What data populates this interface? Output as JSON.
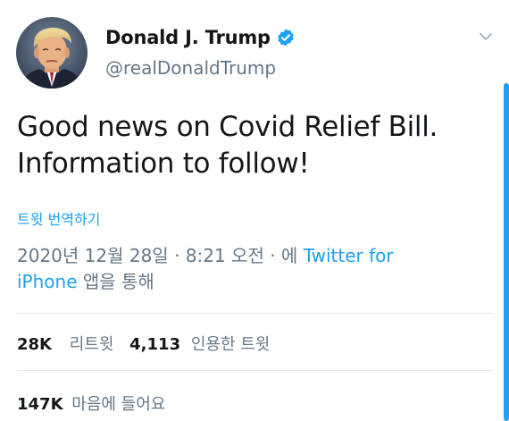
{
  "author": {
    "display_name": "Donald J. Trump",
    "handle": "@realDonaldTrump",
    "verified": true,
    "avatar_icon": "profile-photo"
  },
  "tweet": {
    "text_line1": "Good news on Covid Relief Bill.",
    "text_line2": "Information to follow!",
    "translate_label": "트윗 번역하기"
  },
  "meta": {
    "timestamp": "2020년 12월 28일 · 8:21 오전 · 에 ",
    "source_part1": "Twitter for",
    "source_part2": "iPhone",
    "source_suffix": " 앱을 통해"
  },
  "stats": {
    "retweets_count": "28K",
    "retweets_label": "리트윗",
    "quotes_count": "4,113",
    "quotes_label": "인용한 트윗",
    "likes_count": "147K",
    "likes_label": "마음에 들어요"
  },
  "colors": {
    "accent": "#1da1f2",
    "text_primary": "#14171a",
    "text_secondary": "#657786",
    "divider": "#e1e8ed"
  },
  "icons": {
    "verified": "verified-badge-icon",
    "menu": "chevron-down-icon"
  }
}
